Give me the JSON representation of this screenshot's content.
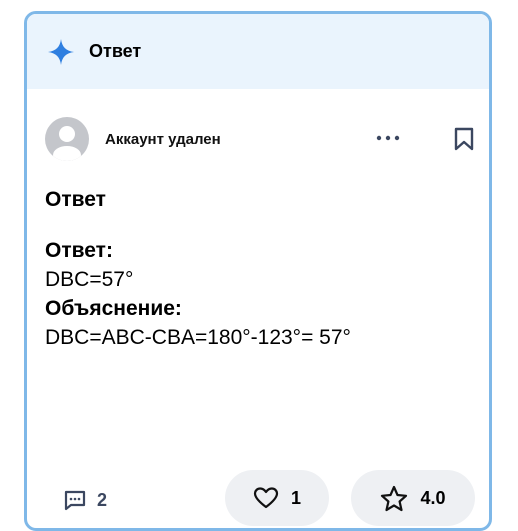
{
  "header": {
    "title": "Ответ",
    "icon": "sparkle-icon",
    "accent": "#2f7fe0"
  },
  "author": {
    "name": "Аккаунт удален"
  },
  "answer": {
    "title": "Ответ",
    "lines": [
      {
        "label": "Ответ:",
        "text": "DBC=57°"
      },
      {
        "label": "Объяснение:",
        "text": "DBC=ABC-CBA=180°-123°= 57°"
      }
    ]
  },
  "footer": {
    "comments_count": "2",
    "likes_count": "1",
    "rating": "4.0"
  }
}
